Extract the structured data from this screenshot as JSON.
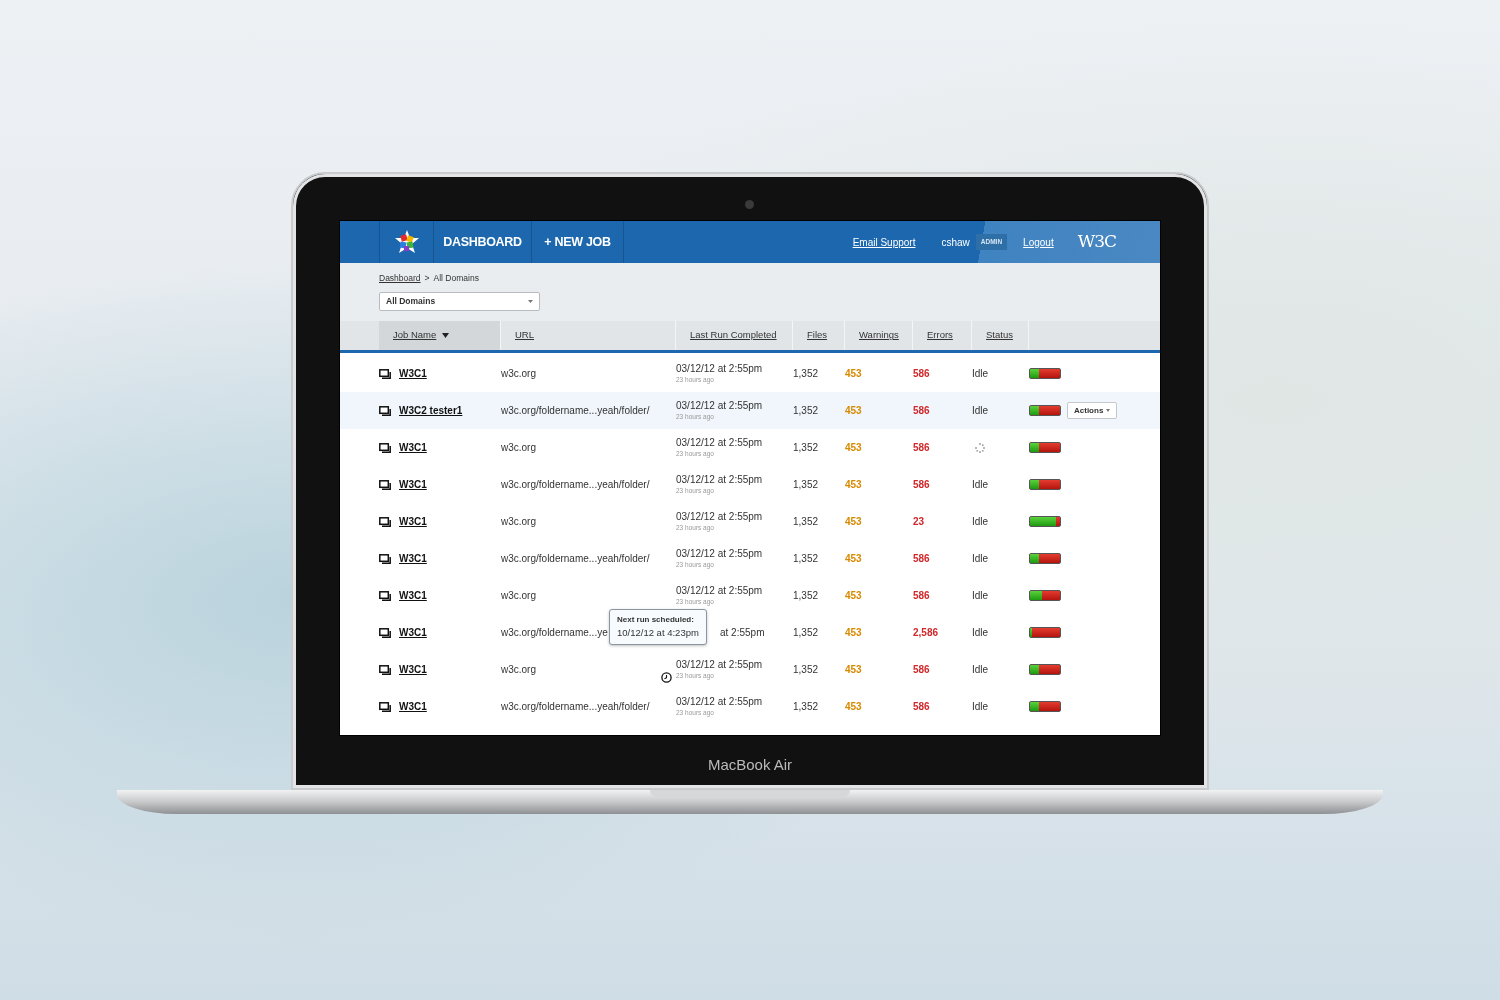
{
  "device": {
    "label": "MacBook Air"
  },
  "header": {
    "tabs": [
      {
        "label": "DASHBOARD"
      },
      {
        "label": "+ NEW JOB"
      }
    ],
    "email_support": "Email Support",
    "user": "cshaw",
    "role": "ADMIN",
    "logout": "Logout",
    "brand": "W3C"
  },
  "breadcrumb": {
    "link": "Dashboard",
    "separator": ">",
    "current": "All Domains"
  },
  "filter": {
    "value": "All Domains"
  },
  "columns": [
    {
      "label": "Job Name",
      "sorted": true
    },
    {
      "label": "URL",
      "sorted": false
    },
    {
      "label": "Last Run Completed",
      "sorted": false
    },
    {
      "label": "Files",
      "sorted": false
    },
    {
      "label": "Warnings",
      "sorted": false
    },
    {
      "label": "Errors",
      "sorted": false
    },
    {
      "label": "Status",
      "sorted": false
    }
  ],
  "rows": [
    {
      "name": "W3C1",
      "url": "w3c.org",
      "date": "03/12/12 at 2:55pm",
      "ago": "23 hours ago",
      "files": "1,352",
      "warnings": "453",
      "errors": "586",
      "status": "Idle",
      "running": false,
      "level": 0.3,
      "selected": false
    },
    {
      "name": "W3C2 tester1",
      "url": "w3c.org/foldername...yeah/folder/",
      "date": "03/12/12 at 2:55pm",
      "ago": "23 hours ago",
      "files": "1,352",
      "warnings": "453",
      "errors": "586",
      "status": "Idle",
      "running": false,
      "level": 0.3,
      "selected": true,
      "actions": "Actions"
    },
    {
      "name": "W3C1",
      "url": "w3c.org",
      "date": "03/12/12 at 2:55pm",
      "ago": "23 hours ago",
      "files": "1,352",
      "warnings": "453",
      "errors": "586",
      "running": true,
      "level": 0.3,
      "selected": false
    },
    {
      "name": "W3C1",
      "url": "w3c.org/foldername...yeah/folder/",
      "date": "03/12/12 at 2:55pm",
      "ago": "23 hours ago",
      "files": "1,352",
      "warnings": "453",
      "errors": "586",
      "status": "Idle",
      "running": false,
      "level": 0.3,
      "selected": false
    },
    {
      "name": "W3C1",
      "url": "w3c.org",
      "date": "03/12/12 at 2:55pm",
      "ago": "23 hours ago",
      "files": "1,352",
      "warnings": "453",
      "errors": "23",
      "status": "Idle",
      "running": false,
      "level": 0.85,
      "selected": false
    },
    {
      "name": "W3C1",
      "url": "w3c.org/foldername...yeah/folder/",
      "date": "03/12/12 at 2:55pm",
      "ago": "23 hours ago",
      "files": "1,352",
      "warnings": "453",
      "errors": "586",
      "status": "Idle",
      "running": false,
      "level": 0.3,
      "selected": false
    },
    {
      "name": "W3C1",
      "url": "w3c.org",
      "date": "03/12/12 at 2:55pm",
      "ago": "23 hours ago",
      "files": "1,352",
      "warnings": "453",
      "errors": "586",
      "status": "Idle",
      "running": false,
      "level": 0.4,
      "selected": false
    },
    {
      "name": "W3C1",
      "url": "w3c.org/foldername...ye",
      "date": "at 2:55pm",
      "files": "1,352",
      "warnings": "453",
      "errors": "2,586",
      "status": "Idle",
      "running": false,
      "level": 0.08,
      "selected": false,
      "tooltip": {
        "title": "Next run scheduled:",
        "text": "10/12/12 at 4:23pm"
      }
    },
    {
      "name": "W3C1",
      "url": "w3c.org",
      "date": "03/12/12 at 2:55pm",
      "ago": "23 hours ago",
      "files": "1,352",
      "warnings": "453",
      "errors": "586",
      "status": "Idle",
      "running": false,
      "level": 0.3,
      "selected": false,
      "scheduled": true
    },
    {
      "name": "W3C1",
      "url": "w3c.org/foldername...yeah/folder/",
      "date": "03/12/12 at 2:55pm",
      "ago": "23 hours ago",
      "files": "1,352",
      "warnings": "453",
      "errors": "586",
      "status": "Idle",
      "running": false,
      "level": 0.3,
      "selected": false
    }
  ]
}
